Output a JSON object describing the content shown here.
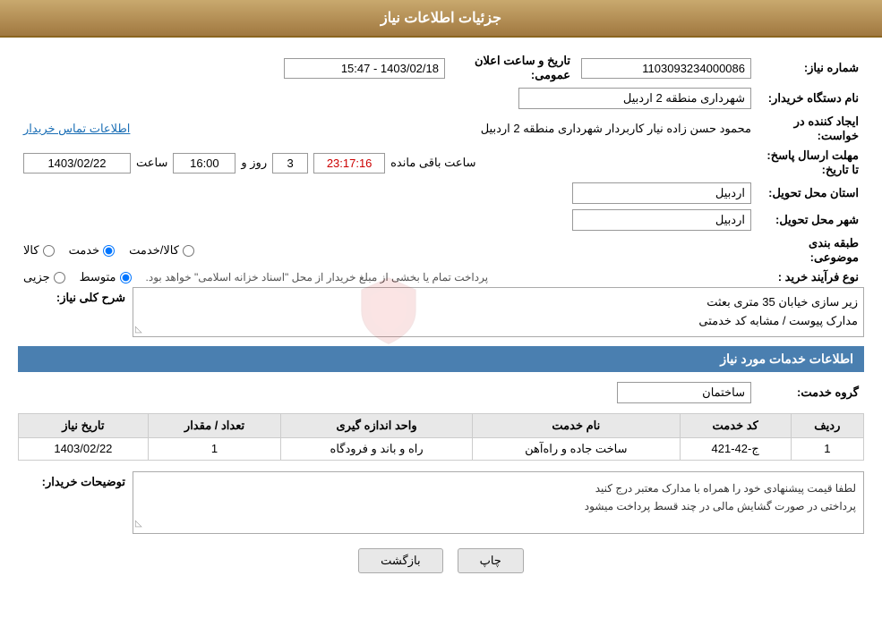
{
  "header": {
    "title": "جزئیات اطلاعات نیاز"
  },
  "fields": {
    "need_number_label": "شماره نیاز:",
    "need_number_value": "1103093234000086",
    "announce_date_label": "تاریخ و ساعت اعلان عمومی:",
    "announce_date_value": "1403/02/18 - 15:47",
    "buyer_org_label": "نام دستگاه خریدار:",
    "buyer_org_value": "شهرداری منطقه 2 اردبیل",
    "creator_label": "ایجاد کننده در خواست:",
    "creator_value": "محمود حسن زاده نیار کاربردار شهرداری منطقه 2 اردبیل",
    "creator_link": "اطلاعات تماس خریدار",
    "deadline_label": "مهلت ارسال پاسخ: تا تاریخ:",
    "deadline_date": "1403/02/22",
    "deadline_time_label": "ساعت",
    "deadline_time": "16:00",
    "deadline_days_label": "روز و",
    "deadline_days": "3",
    "deadline_remaining_label": "ساعت باقی مانده",
    "deadline_remaining": "23:17:16",
    "province_label": "استان محل تحویل:",
    "province_value": "اردبیل",
    "city_label": "شهر محل تحویل:",
    "city_value": "اردبیل",
    "category_label": "طبقه بندی موضوعی:",
    "category_options": [
      "کالا",
      "خدمت",
      "کالا/خدمت"
    ],
    "category_selected": "خدمت",
    "purchase_type_label": "نوع فرآیند خرید :",
    "purchase_type_options": [
      "جزیی",
      "متوسط"
    ],
    "purchase_type_selected": "متوسط",
    "purchase_type_note": "پرداخت تمام یا بخشی از مبلغ خریدار از محل \"اسناد خزانه اسلامی\" خواهد بود.",
    "need_description_label": "شرح کلی نیاز:",
    "need_description_value": "زیر سازی خیابان 35 متری بعثت\nمدارک پیوست / مشابه کد خدمتی",
    "services_section_label": "اطلاعات خدمات مورد نیاز",
    "service_group_label": "گروه خدمت:",
    "service_group_value": "ساختمان",
    "services_table": {
      "columns": [
        "ردیف",
        "کد خدمت",
        "نام خدمت",
        "واحد اندازه گیری",
        "تعداد / مقدار",
        "تاریخ نیاز"
      ],
      "rows": [
        {
          "row": "1",
          "code": "ج-42-421",
          "name": "ساخت جاده و راه‌آهن",
          "unit": "راه و باند و فرودگاه",
          "qty": "1",
          "date": "1403/02/22"
        }
      ]
    },
    "buyer_desc_label": "توضیحات خریدار:",
    "buyer_desc_value": "لطفا قیمت پیشنهادی خود را همراه با مدارک معتبر درج کنید\nپرداختی در صورت گشایش مالی در چند قسط پرداخت میشود"
  },
  "buttons": {
    "print_label": "چاپ",
    "back_label": "بازگشت"
  }
}
